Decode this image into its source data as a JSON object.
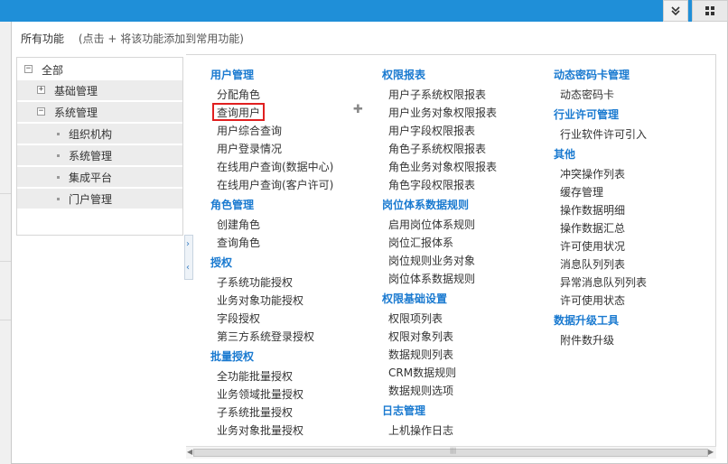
{
  "header": {
    "collapse_icon": "chevron-double-down-icon",
    "grid_icon": "grid-icon"
  },
  "panel": {
    "title": "所有功能",
    "hint": "(点击 + 将该功能添加到常用功能)"
  },
  "tree": {
    "root": "全部",
    "nodes": [
      {
        "label": "基础管理",
        "expanded": false
      },
      {
        "label": "系统管理",
        "expanded": true
      }
    ],
    "leaves": [
      "组织机构",
      "系统管理",
      "集成平台",
      "门户管理"
    ]
  },
  "columns": [
    {
      "sections": [
        {
          "title": "用户管理",
          "items": [
            "分配角色",
            "查询用户",
            "用户综合查询",
            "用户登录情况",
            "在线用户查询(数据中心)",
            "在线用户查询(客户许可)"
          ]
        },
        {
          "title": "角色管理",
          "items": [
            "创建角色",
            "查询角色"
          ]
        },
        {
          "title": "授权",
          "items": [
            "子系统功能授权",
            "业务对象功能授权",
            "字段授权",
            "第三方系统登录授权"
          ]
        },
        {
          "title": "批量授权",
          "items": [
            "全功能批量授权",
            "业务领域批量授权",
            "子系统批量授权",
            "业务对象批量授权"
          ]
        }
      ]
    },
    {
      "sections": [
        {
          "title": "权限报表",
          "items": [
            "用户子系统权限报表",
            "用户业务对象权限报表",
            "用户字段权限报表",
            "角色子系统权限报表",
            "角色业务对象权限报表",
            "角色字段权限报表"
          ]
        },
        {
          "title": "岗位体系数据规则",
          "items": [
            "启用岗位体系规则",
            "岗位汇报体系",
            "岗位规则业务对象",
            "岗位体系数据规则"
          ]
        },
        {
          "title": "权限基础设置",
          "items": [
            "权限项列表",
            "权限对象列表",
            "数据规则列表",
            "CRM数据规则",
            "数据规则选项"
          ]
        },
        {
          "title": "日志管理",
          "items": [
            "上机操作日志"
          ]
        }
      ]
    },
    {
      "sections": [
        {
          "title": "动态密码卡管理",
          "items": [
            "动态密码卡"
          ]
        },
        {
          "title": "行业许可管理",
          "items": [
            "行业软件许可引入"
          ]
        },
        {
          "title": "其他",
          "items": [
            "冲突操作列表",
            "缓存管理",
            "操作数据明细",
            "操作数据汇总",
            "许可使用状况",
            "消息队列列表",
            "异常消息队列列表",
            "许可使用状态"
          ]
        },
        {
          "title": "数据升级工具",
          "items": [
            "附件数升级"
          ]
        }
      ]
    }
  ],
  "selected_item": "查询用户",
  "colors": {
    "topbar": "#1f8fd8",
    "section_title": "#1a7ad0",
    "highlight": "#e02020"
  }
}
